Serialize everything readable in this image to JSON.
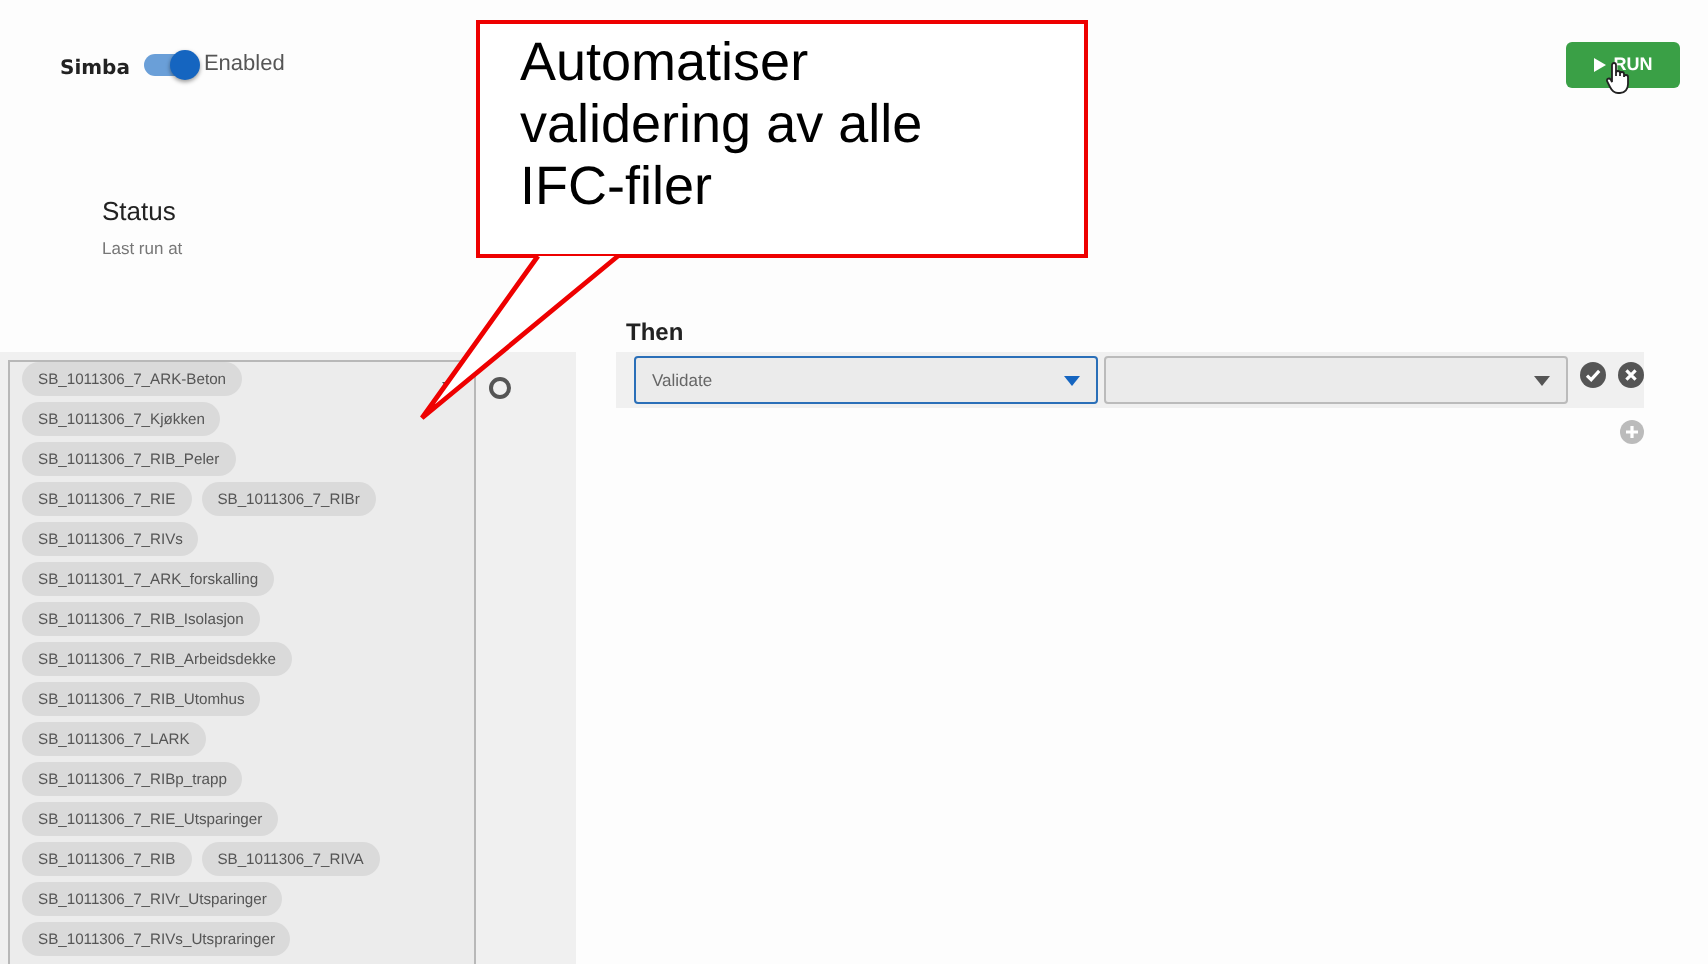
{
  "header": {
    "app_name": "Simba",
    "toggle": {
      "on": true,
      "label": "Enabled"
    },
    "run_button": "RUN"
  },
  "status": {
    "title": "Status",
    "subtitle": "Last run at"
  },
  "tags": [
    "SB_1011306_7_ARK-Beton",
    "SB_1011306_7_Kjøkken",
    "SB_1011306_7_RIB_Peler",
    "SB_1011306_7_RIE",
    "SB_1011306_7_RIBr",
    "SB_1011306_7_RIVs",
    "SB_1011301_7_ARK_forskalling",
    "SB_1011306_7_RIB_Isolasjon",
    "SB_1011306_7_RIB_Arbeidsdekke",
    "SB_1011306_7_RIB_Utomhus",
    "SB_1011306_7_LARK",
    "SB_1011306_7_RIBp_trapp",
    "SB_1011306_7_RIE_Utsparinger",
    "SB_1011306_7_RIB",
    "SB_1011306_7_RIVA",
    "SB_1011306_7_RIVr_Utsparinger",
    "SB_1011306_7_RIVs_Utspraringer"
  ],
  "then": {
    "title": "Then",
    "action_select": {
      "value": "Validate",
      "focused": true
    },
    "target_select": {
      "focused": false
    }
  },
  "callout": {
    "text": "Automatiser validering av alle IFC-filer"
  }
}
